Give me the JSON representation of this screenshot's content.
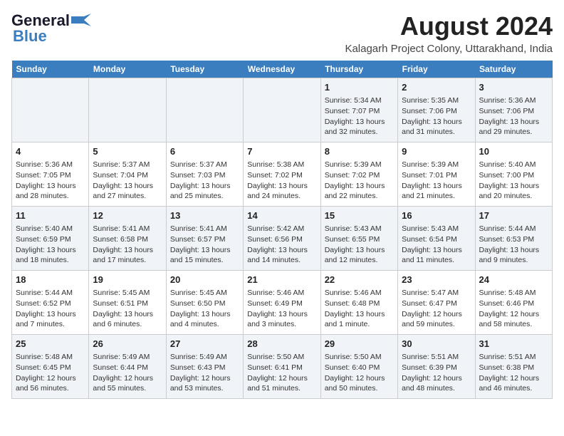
{
  "logo": {
    "line1": "General",
    "line2": "Blue"
  },
  "title": "August 2024",
  "subtitle": "Kalagarh Project Colony, Uttarakhand, India",
  "days_of_week": [
    "Sunday",
    "Monday",
    "Tuesday",
    "Wednesday",
    "Thursday",
    "Friday",
    "Saturday"
  ],
  "weeks": [
    [
      {
        "day": "",
        "info": ""
      },
      {
        "day": "",
        "info": ""
      },
      {
        "day": "",
        "info": ""
      },
      {
        "day": "",
        "info": ""
      },
      {
        "day": "1",
        "info": "Sunrise: 5:34 AM\nSunset: 7:07 PM\nDaylight: 13 hours\nand 32 minutes."
      },
      {
        "day": "2",
        "info": "Sunrise: 5:35 AM\nSunset: 7:06 PM\nDaylight: 13 hours\nand 31 minutes."
      },
      {
        "day": "3",
        "info": "Sunrise: 5:36 AM\nSunset: 7:06 PM\nDaylight: 13 hours\nand 29 minutes."
      }
    ],
    [
      {
        "day": "4",
        "info": "Sunrise: 5:36 AM\nSunset: 7:05 PM\nDaylight: 13 hours\nand 28 minutes."
      },
      {
        "day": "5",
        "info": "Sunrise: 5:37 AM\nSunset: 7:04 PM\nDaylight: 13 hours\nand 27 minutes."
      },
      {
        "day": "6",
        "info": "Sunrise: 5:37 AM\nSunset: 7:03 PM\nDaylight: 13 hours\nand 25 minutes."
      },
      {
        "day": "7",
        "info": "Sunrise: 5:38 AM\nSunset: 7:02 PM\nDaylight: 13 hours\nand 24 minutes."
      },
      {
        "day": "8",
        "info": "Sunrise: 5:39 AM\nSunset: 7:02 PM\nDaylight: 13 hours\nand 22 minutes."
      },
      {
        "day": "9",
        "info": "Sunrise: 5:39 AM\nSunset: 7:01 PM\nDaylight: 13 hours\nand 21 minutes."
      },
      {
        "day": "10",
        "info": "Sunrise: 5:40 AM\nSunset: 7:00 PM\nDaylight: 13 hours\nand 20 minutes."
      }
    ],
    [
      {
        "day": "11",
        "info": "Sunrise: 5:40 AM\nSunset: 6:59 PM\nDaylight: 13 hours\nand 18 minutes."
      },
      {
        "day": "12",
        "info": "Sunrise: 5:41 AM\nSunset: 6:58 PM\nDaylight: 13 hours\nand 17 minutes."
      },
      {
        "day": "13",
        "info": "Sunrise: 5:41 AM\nSunset: 6:57 PM\nDaylight: 13 hours\nand 15 minutes."
      },
      {
        "day": "14",
        "info": "Sunrise: 5:42 AM\nSunset: 6:56 PM\nDaylight: 13 hours\nand 14 minutes."
      },
      {
        "day": "15",
        "info": "Sunrise: 5:43 AM\nSunset: 6:55 PM\nDaylight: 13 hours\nand 12 minutes."
      },
      {
        "day": "16",
        "info": "Sunrise: 5:43 AM\nSunset: 6:54 PM\nDaylight: 13 hours\nand 11 minutes."
      },
      {
        "day": "17",
        "info": "Sunrise: 5:44 AM\nSunset: 6:53 PM\nDaylight: 13 hours\nand 9 minutes."
      }
    ],
    [
      {
        "day": "18",
        "info": "Sunrise: 5:44 AM\nSunset: 6:52 PM\nDaylight: 13 hours\nand 7 minutes."
      },
      {
        "day": "19",
        "info": "Sunrise: 5:45 AM\nSunset: 6:51 PM\nDaylight: 13 hours\nand 6 minutes."
      },
      {
        "day": "20",
        "info": "Sunrise: 5:45 AM\nSunset: 6:50 PM\nDaylight: 13 hours\nand 4 minutes."
      },
      {
        "day": "21",
        "info": "Sunrise: 5:46 AM\nSunset: 6:49 PM\nDaylight: 13 hours\nand 3 minutes."
      },
      {
        "day": "22",
        "info": "Sunrise: 5:46 AM\nSunset: 6:48 PM\nDaylight: 13 hours\nand 1 minute."
      },
      {
        "day": "23",
        "info": "Sunrise: 5:47 AM\nSunset: 6:47 PM\nDaylight: 12 hours\nand 59 minutes."
      },
      {
        "day": "24",
        "info": "Sunrise: 5:48 AM\nSunset: 6:46 PM\nDaylight: 12 hours\nand 58 minutes."
      }
    ],
    [
      {
        "day": "25",
        "info": "Sunrise: 5:48 AM\nSunset: 6:45 PM\nDaylight: 12 hours\nand 56 minutes."
      },
      {
        "day": "26",
        "info": "Sunrise: 5:49 AM\nSunset: 6:44 PM\nDaylight: 12 hours\nand 55 minutes."
      },
      {
        "day": "27",
        "info": "Sunrise: 5:49 AM\nSunset: 6:43 PM\nDaylight: 12 hours\nand 53 minutes."
      },
      {
        "day": "28",
        "info": "Sunrise: 5:50 AM\nSunset: 6:41 PM\nDaylight: 12 hours\nand 51 minutes."
      },
      {
        "day": "29",
        "info": "Sunrise: 5:50 AM\nSunset: 6:40 PM\nDaylight: 12 hours\nand 50 minutes."
      },
      {
        "day": "30",
        "info": "Sunrise: 5:51 AM\nSunset: 6:39 PM\nDaylight: 12 hours\nand 48 minutes."
      },
      {
        "day": "31",
        "info": "Sunrise: 5:51 AM\nSunset: 6:38 PM\nDaylight: 12 hours\nand 46 minutes."
      }
    ]
  ]
}
